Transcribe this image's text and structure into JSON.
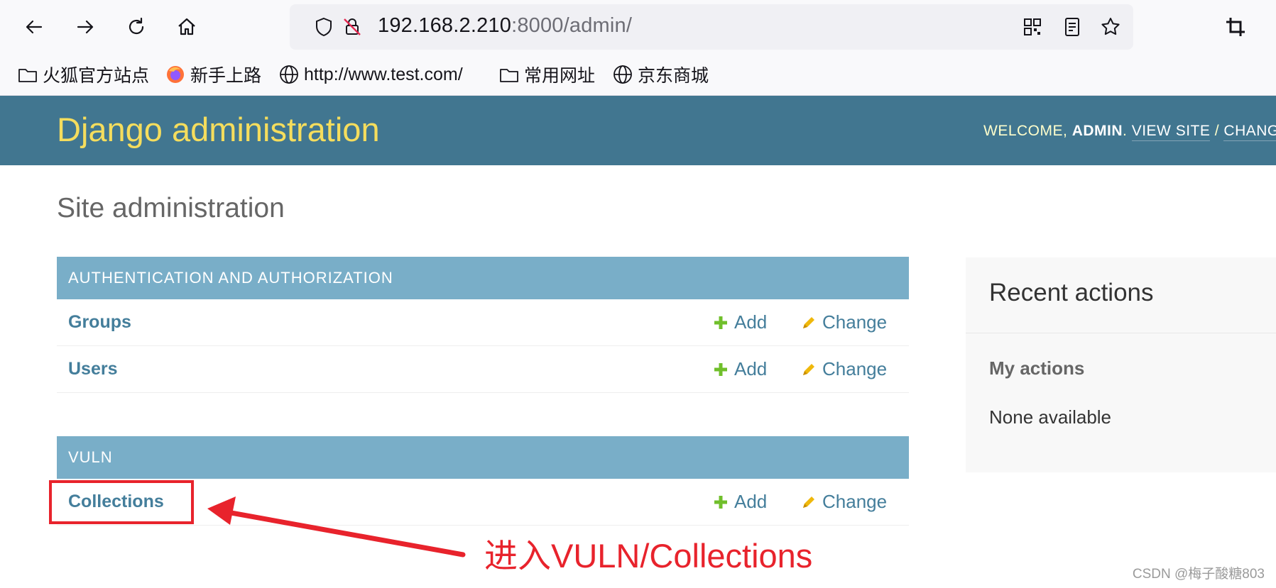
{
  "browser": {
    "url_host": "192.168.2.210",
    "url_path": ":8000/admin/",
    "bookmarks": [
      {
        "label": "火狐官方站点",
        "icon": "folder-icon"
      },
      {
        "label": "新手上路",
        "icon": "firefox-icon"
      },
      {
        "label": "http://www.test.com/",
        "icon": "globe-icon"
      },
      {
        "label": "常用网址",
        "icon": "folder-icon"
      },
      {
        "label": "京东商城",
        "icon": "globe-icon"
      }
    ]
  },
  "header": {
    "branding": "Django administration",
    "welcome": "WELCOME,",
    "username": "ADMIN",
    "view_site": "VIEW SITE",
    "separator": "/",
    "change_password": "CHANG"
  },
  "page_title": "Site administration",
  "modules": [
    {
      "caption": "AUTHENTICATION AND AUTHORIZATION",
      "models": [
        {
          "name": "Groups",
          "add": "Add",
          "change": "Change"
        },
        {
          "name": "Users",
          "add": "Add",
          "change": "Change"
        }
      ]
    },
    {
      "caption": "VULN",
      "models": [
        {
          "name": "Collections",
          "add": "Add",
          "change": "Change"
        }
      ]
    }
  ],
  "recent_actions": {
    "title": "Recent actions",
    "my_actions": "My actions",
    "none": "None available"
  },
  "annotation": {
    "text": "进入VULN/Collections",
    "color": "#e8232c"
  },
  "watermark": "CSDN @梅子酸糖803",
  "colors": {
    "header_bg": "#417690",
    "branding": "#f5dd5d",
    "caption_bg": "#79aec8",
    "link": "#447e9b",
    "add_icon": "#70bf2b",
    "change_icon": "#efb80b"
  }
}
